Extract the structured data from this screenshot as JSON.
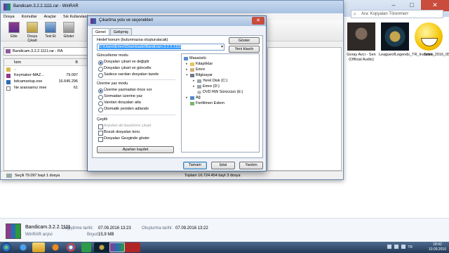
{
  "explorer": {
    "search_placeholder": "Ara: Kopyalan Törenmerr",
    "tiles": [
      {
        "label": "Goray Avcı - Sen (Official Audio)",
        "thumb": "photo"
      },
      {
        "label": "LeagueofLegends_TR_Installer_2016_05_13",
        "thumb": "lol"
      },
      {
        "label": "Smile",
        "thumb": "smile"
      }
    ]
  },
  "winrar": {
    "title": "Bandicam.3.2.2.1111.rar - WinRAR",
    "menu": [
      "Dosya",
      "Komutlar",
      "Araçlar",
      "Sık Kullanılanlar"
    ],
    "toolbar": [
      {
        "label": "Ekle",
        "icon": "add-icon"
      },
      {
        "label": "Dosya Çıkart",
        "icon": "extract-icon"
      },
      {
        "label": "Test Et",
        "icon": "test-icon"
      },
      {
        "label": "Göster",
        "icon": "view-icon"
      }
    ],
    "path": "Bandicam.3.2.2.1111.rar - RA",
    "list": {
      "headers": [
        "İsim",
        "B"
      ],
      "rows": [
        {
          "name": "..",
          "size": "",
          "icon": "up"
        },
        {
          "name": "Keymaker-MAZ...",
          "size": "79.097",
          "icon": "rar"
        },
        {
          "name": "bdcamsetup.exe",
          "size": "16.645.296",
          "icon": "exe"
        },
        {
          "name": "Ne aransamız mee...",
          "size": "61",
          "icon": "doc"
        }
      ]
    },
    "status_left": "Seçili 79.097 bayt 1 dosya",
    "status_right": "Toplam 16.724.454 bayt 3 dosya"
  },
  "dialog": {
    "title": "Çıkartma yolu ve seçenekleri",
    "tabs": [
      "Genel",
      "Gelişmiş"
    ],
    "path_label": "Hedef konum (bulunmazsa oluşturulacak)",
    "path_value": "C:\\Users\\Emre\\Downloads\\Bandicam.3.2.2.1111",
    "show_button": "Göster",
    "new_folder_button": "Yeni klasör",
    "update_mode": {
      "title": "Güncelleme modu",
      "options": [
        {
          "label": "Dosyaları çıkart ve değiştir",
          "selected": true
        },
        {
          "label": "Dosyaları çıkart ve güncelle",
          "selected": false
        },
        {
          "label": "Sadece varolan dosyaları tazele",
          "selected": false
        }
      ]
    },
    "overwrite_mode": {
      "title": "Üzerine yaz modu",
      "options": [
        {
          "label": "Üzerine yazmadan önce sor",
          "selected": true
        },
        {
          "label": "Sormadan üzerine yaz",
          "selected": false
        },
        {
          "label": "Varolan dosyaları atla",
          "selected": false
        },
        {
          "label": "Otomatik yeniden adlandır",
          "selected": false
        }
      ]
    },
    "misc": {
      "title": "Çeşitli",
      "options": [
        {
          "label": "Arşivleri alt klasörlere çıkart",
          "checked": false,
          "disabled": true
        },
        {
          "label": "Bozuk dosyaları koru",
          "checked": false,
          "disabled": false
        },
        {
          "label": "Dosyaları Gezginde göster",
          "checked": false,
          "disabled": false
        }
      ]
    },
    "save_settings_button": "Ayarları kaydet",
    "tree": [
      {
        "label": "Masaüstü",
        "icon": "desktop-icon",
        "level": 0
      },
      {
        "label": "Kitaplıklar",
        "icon": "folder-icon",
        "level": 1
      },
      {
        "label": "Emre",
        "icon": "user-folder-icon",
        "level": 1
      },
      {
        "label": "Bilgisayar",
        "icon": "computer-icon",
        "level": 1
      },
      {
        "label": "Yerel Disk (C:)",
        "icon": "drive-icon",
        "level": 2
      },
      {
        "label": "Emre (D:)",
        "icon": "drive-icon",
        "level": 2
      },
      {
        "label": "DVD RW Sürücüsü (E:)",
        "icon": "dvd-icon",
        "level": 2
      },
      {
        "label": "Ağ",
        "icon": "network-icon",
        "level": 1
      },
      {
        "label": "Feriltimen Eslem",
        "icon": "folder-icon",
        "level": 1
      }
    ],
    "ok_button": "Tamam",
    "cancel_button": "İptal",
    "help_button": "Yardım"
  },
  "details": {
    "filename": "Bandicam.3.2.2.1111",
    "type": "WinRAR arşivi",
    "modified_label": "Değiştirme tarihi:",
    "modified_value": "07.09.2016 13:23",
    "size_label": "Boyut:",
    "size_value": "15,9 MB",
    "created_label": "Oluşturma tarihi:",
    "created_value": "07.09.2016 13:22"
  },
  "taskbar": {
    "language": "TR",
    "time": "18:42",
    "date": "10.09.2016"
  }
}
